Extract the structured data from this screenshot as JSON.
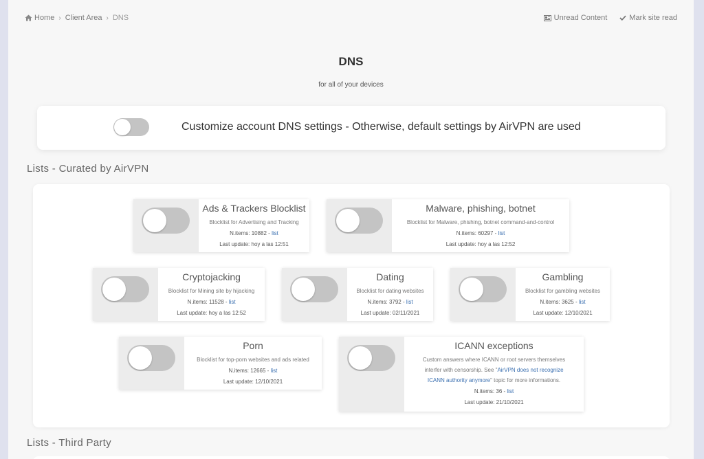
{
  "breadcrumb": {
    "home": "Home",
    "client_area": "Client Area",
    "current": "DNS"
  },
  "top_actions": {
    "unread": "Unread Content",
    "mark_read": "Mark site read"
  },
  "title": "DNS",
  "subtitle": "for all of your devices",
  "customize": {
    "label": "Customize account DNS settings - Otherwise, default settings by AirVPN are used",
    "enabled": false
  },
  "sections": {
    "curated": "Lists - Curated by AirVPN",
    "third_party": "Lists - Third Party"
  },
  "common": {
    "items_prefix": "N.items: ",
    "list_link": "list",
    "update_prefix": "Last update: "
  },
  "lists": {
    "ads": {
      "name": "Ads & Trackers Blocklist",
      "desc": "Blocklist for Advertising and Tracking",
      "items": "10882",
      "updated": "hoy a las 12:51"
    },
    "malware": {
      "name": "Malware, phishing, botnet",
      "desc": "Blocklist for Malware, phishing, botnet command-and-control",
      "items": "60297",
      "updated": "hoy a las 12:52"
    },
    "crypto": {
      "name": "Cryptojacking",
      "desc": "Blocklist for Mining site by hijacking",
      "items": "11528",
      "updated": "hoy a las 12:52"
    },
    "dating": {
      "name": "Dating",
      "desc": "Blocklist for dating websites",
      "items": "3792",
      "updated": "02/11/2021"
    },
    "gambling": {
      "name": "Gambling",
      "desc": "Blocklist for gambling websites",
      "items": "3625",
      "updated": "12/10/2021"
    },
    "porn": {
      "name": "Porn",
      "desc": "Blocklist for top-porn websites and ads related",
      "items": "12665",
      "updated": "12/10/2021"
    },
    "icann": {
      "name": "ICANN exceptions",
      "desc_line1": "Custom answers where ICANN or root servers themselves",
      "desc_line2_pre": "interfer with censorship. See \"",
      "desc_link_part1": "AirVPN does not recognize",
      "desc_link_part2": "ICANN authority anymore",
      "desc_line3_post": "\" topic for more informations.",
      "items": "36",
      "updated": "21/10/2021"
    }
  }
}
